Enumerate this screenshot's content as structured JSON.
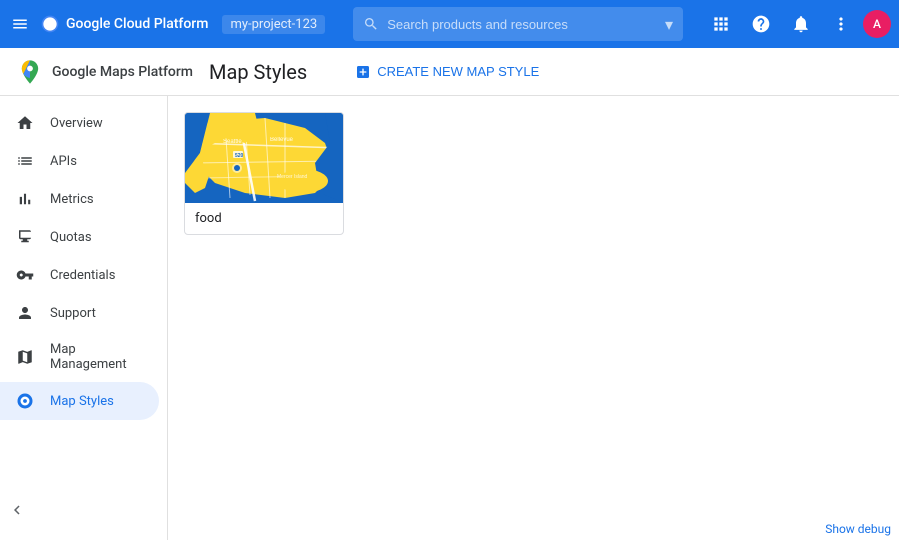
{
  "header": {
    "title": "Google Cloud Platform",
    "project": "my-project-123",
    "search_placeholder": "Search products and resources",
    "menu_icon": "menu-icon",
    "grid_icon": "apps-icon",
    "help_icon": "help-icon",
    "bell_icon": "notifications-icon",
    "more_icon": "more-vert-icon",
    "avatar_label": "A"
  },
  "sub_header": {
    "app_name": "Google Maps Platform",
    "page_title": "Map Styles",
    "create_button_label": "CREATE NEW MAP STYLE",
    "create_icon": "add-box-icon"
  },
  "sidebar": {
    "items": [
      {
        "id": "overview",
        "label": "Overview",
        "icon": "home-icon",
        "active": false
      },
      {
        "id": "apis",
        "label": "APIs",
        "icon": "list-icon",
        "active": false
      },
      {
        "id": "metrics",
        "label": "Metrics",
        "icon": "bar-chart-icon",
        "active": false
      },
      {
        "id": "quotas",
        "label": "Quotas",
        "icon": "monitor-icon",
        "active": false
      },
      {
        "id": "credentials",
        "label": "Credentials",
        "icon": "vpn-key-icon",
        "active": false
      },
      {
        "id": "support",
        "label": "Support",
        "icon": "person-icon",
        "active": false
      },
      {
        "id": "map-management",
        "label": "Map Management",
        "icon": "map-management-icon",
        "active": false
      },
      {
        "id": "map-styles",
        "label": "Map Styles",
        "icon": "map-styles-icon",
        "active": true
      }
    ],
    "collapse_icon": "chevron-left-icon"
  },
  "main": {
    "map_card": {
      "label": "food",
      "thumbnail_alt": "Seattle map thumbnail with blue and yellow color scheme"
    }
  },
  "footer": {
    "debug_label": "Show debug"
  }
}
